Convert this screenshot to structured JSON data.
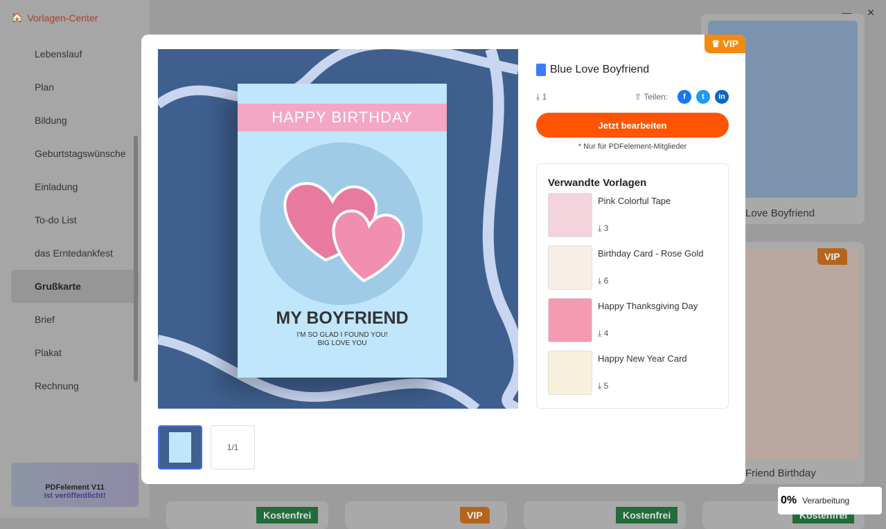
{
  "app": {
    "title": "Vorlagen-Center"
  },
  "sidebar": {
    "items": [
      {
        "label": "Lebenslauf"
      },
      {
        "label": "Plan"
      },
      {
        "label": "Bildung"
      },
      {
        "label": "Geburtstagswünsche"
      },
      {
        "label": "Einladung"
      },
      {
        "label": "To-do List"
      },
      {
        "label": "das Erntedankfest"
      },
      {
        "label": "Grußkarte",
        "active": true
      },
      {
        "label": "Brief"
      },
      {
        "label": "Plakat"
      },
      {
        "label": "Rechnung"
      }
    ],
    "promo": {
      "line1": "PDFelement V11",
      "line2": "ist veröffentlicht!",
      "logo": "PDFelement"
    }
  },
  "background": {
    "cards": [
      {
        "title": "Love Boyfriend"
      },
      {
        "title": "Friend Birthday",
        "badge": "VIP"
      }
    ],
    "bottom_badges": [
      "Kostenfrei",
      "VIP",
      "Kostenfrei",
      "Kostenfrei"
    ]
  },
  "modal": {
    "vip_label": "VIP",
    "preview": {
      "header": "HAPPY BIRTHDAY",
      "headline": "MY BOYFRIEND",
      "line1": "I'M SO GLAD I FOUND YOU!",
      "line2": "BIG LOVE YOU"
    },
    "title": "Blue Love Boyfriend",
    "downloads": "1",
    "share_label": "Teilen:",
    "social": [
      "facebook",
      "twitter",
      "linkedin"
    ],
    "edit_button": "Jetzt bearbeiten",
    "note": "* Nur für PDFelement-Mitglieder",
    "related": {
      "heading": "Verwandte Vorlagen",
      "items": [
        {
          "name": "Pink Colorful Tape",
          "downloads": "3",
          "thumb": "#f3d3dc"
        },
        {
          "name": "Birthday Card - Rose Gold",
          "downloads": "6",
          "thumb": "#f7eee5"
        },
        {
          "name": "Happy Thanksgiving Day",
          "downloads": "4",
          "thumb": "#f49ab3"
        },
        {
          "name": "Happy New Year Card",
          "downloads": "5",
          "thumb": "#f8f0dc"
        }
      ]
    },
    "page_indicator": "1/1"
  },
  "progress": {
    "percent": "0%",
    "label": "Verarbeitung"
  },
  "colors": {
    "accent": "#ff5500",
    "vip": "#f28a12",
    "preview_bg": "#3f5f8f"
  }
}
